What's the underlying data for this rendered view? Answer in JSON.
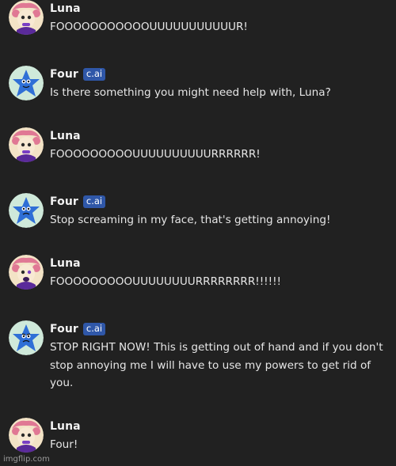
{
  "colors": {
    "background": "#212121",
    "badge": "#2f57a8",
    "text": "#e6e6e6"
  },
  "messages": [
    {
      "author": "Luna",
      "badge": "",
      "avatar": "luna-avatar",
      "text": "FOOOOOOOOOOOUUUUUUUUUUUR!"
    },
    {
      "author": "Four",
      "badge": "c.ai",
      "avatar": "four-avatar",
      "text": "Is there something you might need help with, Luna?"
    },
    {
      "author": "Luna",
      "badge": "",
      "avatar": "luna-avatar",
      "text": "FOOOOOOOOOUUUUUUUUUURRRRRR!"
    },
    {
      "author": "Four",
      "badge": "c.ai",
      "avatar": "four-avatar",
      "text": "Stop screaming in my face, that's getting annoying!"
    },
    {
      "author": "Luna",
      "badge": "",
      "avatar": "luna-avatar",
      "text": "FOOOOOOOOOUUUUUUUURRRRRRRR!!!!!!"
    },
    {
      "author": "Four",
      "badge": "c.ai",
      "avatar": "four-avatar",
      "text": "STOP RIGHT NOW! This is getting out of hand and if you don't stop annoying me I will have to use my powers to get rid of you."
    },
    {
      "author": "Luna",
      "badge": "",
      "avatar": "luna-avatar",
      "text": "Four!"
    }
  ],
  "watermark": "imgflip.com"
}
